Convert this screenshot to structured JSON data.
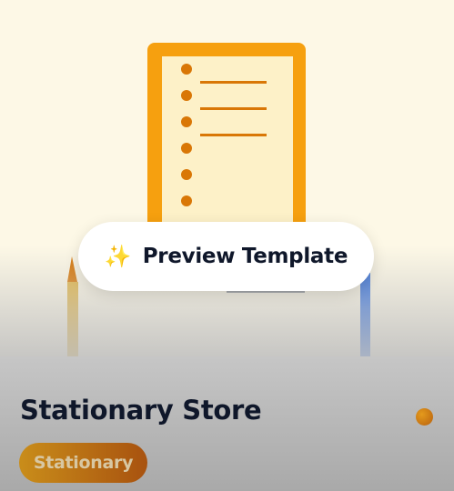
{
  "preview": {
    "icon": "sparkles-icon",
    "icon_glyph": "✨",
    "label": "Preview Template"
  },
  "template": {
    "title": "Stationary Store",
    "category": "Stationary"
  },
  "colors": {
    "accent_orange": "#f59e0b",
    "paper": "#fdf1c8",
    "dot_orange": "#d97706",
    "pencil_yellow": "#e8b84a",
    "pen_blue": "#3b82f6",
    "title_text": "#0f172a"
  }
}
